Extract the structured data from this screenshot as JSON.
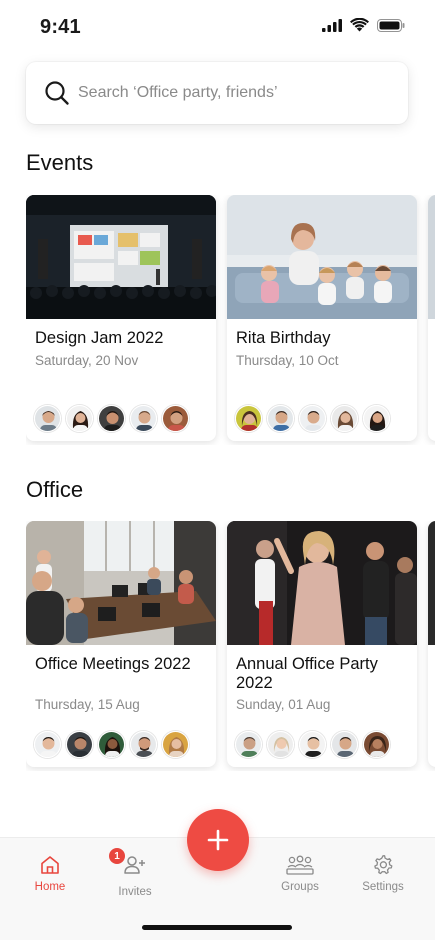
{
  "status_bar": {
    "time": "9:41"
  },
  "search": {
    "placeholder": "Search ‘Office party, friends’"
  },
  "sections": [
    {
      "title": "Events",
      "cards": [
        {
          "title": "Design Jam 2022",
          "date": "Saturday, 20 Nov"
        },
        {
          "title": "Rita Birthday",
          "date": "Thursday, 10 Oct"
        }
      ]
    },
    {
      "title": "Office",
      "cards": [
        {
          "title": "Office Meetings 2022",
          "date": "Thursday, 15 Aug"
        },
        {
          "title": "Annual Office Party 2022",
          "date": "Sunday, 01 Aug"
        }
      ]
    }
  ],
  "fab": {
    "icon": "plus-icon"
  },
  "nav": {
    "items": [
      {
        "label": "Home",
        "icon": "home-icon",
        "active": true
      },
      {
        "label": "Invites",
        "icon": "add-person-icon",
        "badge": "1"
      },
      {
        "label": "Groups",
        "icon": "groups-icon"
      },
      {
        "label": "Settings",
        "icon": "gear-icon"
      }
    ]
  },
  "colors": {
    "accent": "#ee4b43",
    "muted": "#8a8a8a"
  }
}
